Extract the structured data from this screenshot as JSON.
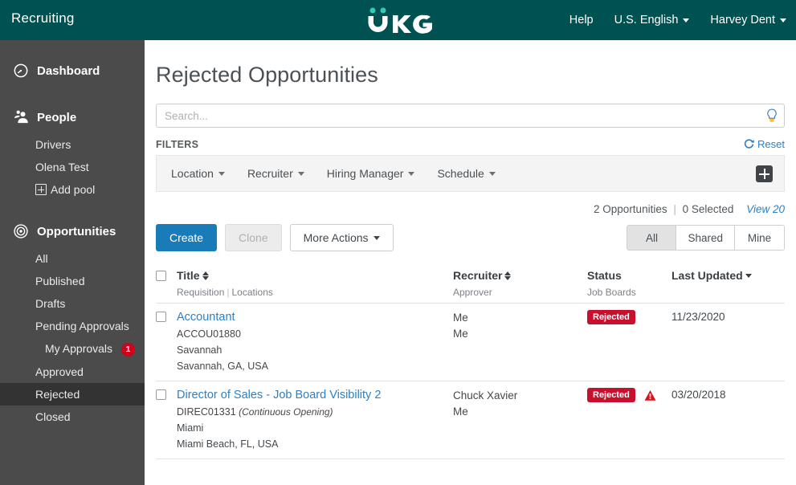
{
  "header": {
    "app_title": "Recruiting",
    "logo_text": "UKG",
    "help_label": "Help",
    "language_label": "U.S. English",
    "user_label": "Harvey Dent",
    "background_color": "#005151",
    "logo_dot_color": "#34cbb5"
  },
  "sidebar": {
    "background_color": "#4b4b4b",
    "active_background_color": "#333333",
    "groups": [
      {
        "label": "Dashboard",
        "icon": "dashboard-clock-icon",
        "items": []
      },
      {
        "label": "People",
        "icon": "people-icon",
        "items": [
          {
            "label": "Drivers",
            "active": false
          },
          {
            "label": "Olena Test",
            "active": false
          },
          {
            "label": "Add pool",
            "active": false,
            "icon": "plus-square-icon"
          }
        ]
      },
      {
        "label": "Opportunities",
        "icon": "bullseye-icon",
        "items": [
          {
            "label": "All",
            "active": false
          },
          {
            "label": "Published",
            "active": false
          },
          {
            "label": "Drafts",
            "active": false
          },
          {
            "label": "Pending Approvals",
            "active": false
          },
          {
            "label": "My Approvals",
            "active": false,
            "badge": "1",
            "indented": true
          },
          {
            "label": "Approved",
            "active": false
          },
          {
            "label": "Rejected",
            "active": true
          },
          {
            "label": "Closed",
            "active": false
          }
        ]
      }
    ]
  },
  "main": {
    "page_title": "Rejected Opportunities",
    "search": {
      "placeholder": "Search...",
      "value": "",
      "icon": "lightbulb-icon"
    },
    "filters": {
      "label": "FILTERS",
      "reset_label": "Reset",
      "reset_icon": "refresh-icon",
      "add_filter_icon": "plus-icon",
      "items": [
        {
          "label": "Location"
        },
        {
          "label": "Recruiter"
        },
        {
          "label": "Hiring Manager"
        },
        {
          "label": "Schedule"
        }
      ]
    },
    "counts": {
      "opportunities": "2 Opportunities",
      "separator": "|",
      "selected": "0 Selected",
      "view_label": "View 20"
    },
    "toolbar": {
      "create_label": "Create",
      "clone_label": "Clone",
      "more_actions_label": "More Actions",
      "segments": [
        {
          "label": "All",
          "active": true
        },
        {
          "label": "Shared",
          "active": false
        },
        {
          "label": "Mine",
          "active": false
        }
      ]
    },
    "table": {
      "columns": {
        "title": {
          "main": "Title",
          "sub_requisition": "Requisition",
          "sub_sep": "|",
          "sub_locations": "Locations",
          "sortable": true
        },
        "recruiter": {
          "main": "Recruiter",
          "sub": "Approver",
          "sortable": true
        },
        "status": {
          "main": "Status",
          "sub": "Job Boards",
          "sortable": false
        },
        "last_updated": {
          "main": "Last Updated",
          "sortable": true,
          "sort_dir": "desc"
        }
      },
      "rows": [
        {
          "selected": false,
          "title": "Accountant",
          "requisition": "ACCOU01880",
          "continuous": "",
          "location_primary": "Savannah",
          "location_secondary": "Savannah, GA, USA",
          "recruiter": "Me",
          "approver": "Me",
          "status": "Rejected",
          "status_color": "#c8102e",
          "warning": false,
          "last_updated": "11/23/2020"
        },
        {
          "selected": false,
          "title": "Director of Sales - Job Board Visibility 2",
          "requisition": "DIREC01331",
          "continuous": "(Continuous Opening)",
          "location_primary": "Miami",
          "location_secondary": "Miami Beach, FL, USA",
          "recruiter": "Chuck Xavier",
          "approver": "Me",
          "status": "Rejected",
          "status_color": "#c8102e",
          "warning": true,
          "warning_icon": "warning-triangle-icon",
          "last_updated": "03/20/2018"
        }
      ]
    }
  }
}
